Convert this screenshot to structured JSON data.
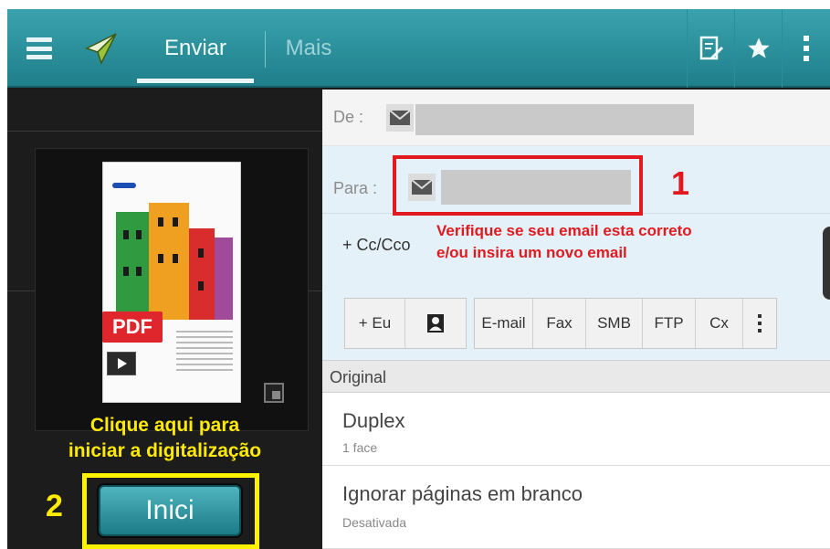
{
  "topbar": {
    "tab_send": "Enviar",
    "tab_more": "Mais",
    "icons": [
      "menu-icon",
      "send-icon",
      "edit-icon",
      "star-icon",
      "more-icon"
    ]
  },
  "preview": {
    "badge": "PDF",
    "caption_line1": "Clique aqui para",
    "caption_line2": "iniciar a digitalização",
    "step_number": "2",
    "start_label": "Inici"
  },
  "recipient": {
    "from_label": "De :",
    "to_label": "Para :",
    "step_number": "1",
    "cc_label": "+ Cc/Cco",
    "note_line1": "Verifique se seu email esta correto",
    "note_line2": "e/ou insira um novo email"
  },
  "destination_buttons": {
    "me": "+ Eu",
    "types": [
      "E-mail",
      "Fax",
      "SMB",
      "FTP",
      "Cx"
    ]
  },
  "options": {
    "section": "Original",
    "items": [
      {
        "title": "Duplex",
        "value": "1 face"
      },
      {
        "title": "Ignorar páginas em branco",
        "value": "Desativada"
      }
    ]
  },
  "colors": {
    "accent": "#1f7f8b",
    "highlight_red": "#e2191f",
    "highlight_yellow": "#fff200"
  }
}
